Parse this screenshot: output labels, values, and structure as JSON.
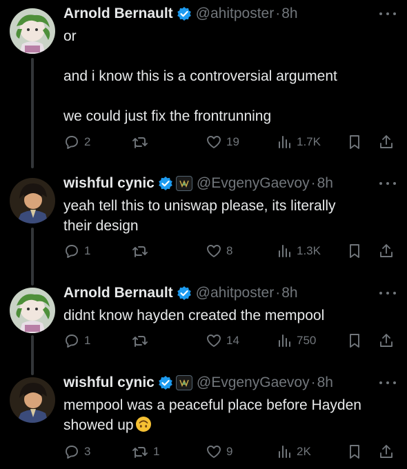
{
  "tweets": [
    {
      "author": {
        "name": "Arnold Bernault",
        "handle": "@ahitposter",
        "time": "8h",
        "affiliation": false
      },
      "lines": [
        "or",
        "",
        "and i know this is a controversial argument",
        "",
        "we could just fix the frontrunning"
      ],
      "replies": "2",
      "reposts": "",
      "likes": "19",
      "views": "1.7K"
    },
    {
      "author": {
        "name": "wishful cynic",
        "handle": "@EvgenyGaevoy",
        "time": "8h",
        "affiliation": true
      },
      "lines": [
        "yeah tell this to uniswap please, its literally",
        "their design"
      ],
      "replies": "1",
      "reposts": "",
      "likes": "8",
      "views": "1.3K"
    },
    {
      "author": {
        "name": "Arnold Bernault",
        "handle": "@ahitposter",
        "time": "8h",
        "affiliation": false
      },
      "lines": [
        "didnt know hayden created the mempool"
      ],
      "replies": "1",
      "reposts": "",
      "likes": "14",
      "views": "750"
    },
    {
      "author": {
        "name": "wishful cynic",
        "handle": "@EvgenyGaevoy",
        "time": "8h",
        "affiliation": true
      },
      "lines": [
        "mempool was a peaceful place before Hayden",
        "showed up"
      ],
      "trailing_emoji": "upside-down-face",
      "replies": "3",
      "reposts": "1",
      "likes": "9",
      "views": "2K"
    }
  ],
  "colors": {
    "background": "#000000",
    "text": "#e7e9ea",
    "muted": "#71767b",
    "verified": "#1d9bf0",
    "thread_line": "#333639"
  }
}
